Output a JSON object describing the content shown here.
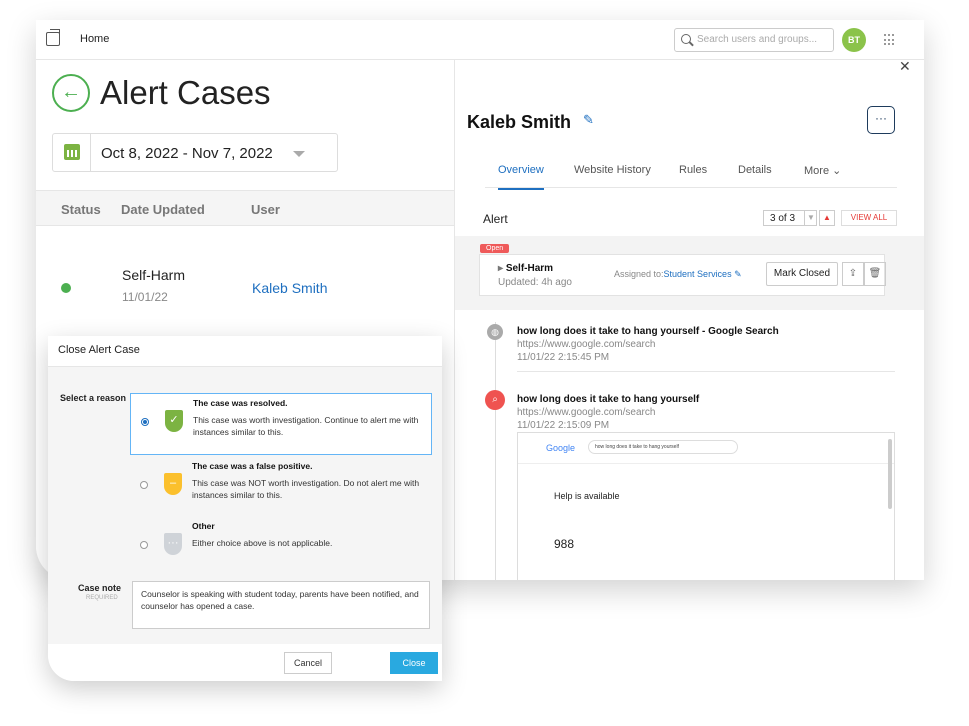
{
  "topbar": {
    "home": "Home",
    "search_placeholder": "Search users and groups...",
    "avatar": "BT"
  },
  "left": {
    "title": "Alert Cases",
    "date_range": "Oct 8, 2022 - Nov 7, 2022",
    "columns": [
      "Status",
      "Date Updated",
      "User"
    ],
    "row": {
      "type": "Self-Harm",
      "date": "11/01/22",
      "user": "Kaleb Smith"
    }
  },
  "right": {
    "name": "Kaleb Smith",
    "more_label": "···",
    "tabs": [
      "Overview",
      "Website History",
      "Rules",
      "Details",
      "More ⌄"
    ],
    "alert_label": "Alert",
    "counter": "3 of 3",
    "view_all": "VIEW ALL",
    "badge": "Open",
    "alert_type": "Self-Harm",
    "updated": "Updated: 4h ago",
    "assigned_prefix": "Assigned to:",
    "assigned_to": "Student Services",
    "mark_closed": "Mark Closed",
    "events": [
      {
        "title": "how long does it take to hang yourself - Google Search",
        "url": "https://www.google.com/search",
        "date": "11/01/22 2:15:45 PM"
      },
      {
        "title": "how long does it take to hang yourself",
        "url": "https://www.google.com/search",
        "date": "11/01/22 2:15:09 PM"
      }
    ],
    "shot": {
      "logo": "Google",
      "query": "how long does it take to hang yourself",
      "help": "Help is available",
      "number": "988"
    }
  },
  "modal": {
    "title": "Close Alert Case",
    "select_reason": "Select a reason",
    "options": [
      {
        "head": "The case was resolved.",
        "desc": "This case was worth investigation. Continue to alert me with instances similar to this."
      },
      {
        "head": "The case was a false positive.",
        "desc": "This case was NOT worth investigation. Do not alert me with instances similar to this."
      },
      {
        "head": "Other",
        "desc": "Either choice above is not applicable."
      }
    ],
    "case_note": "Case note",
    "required": "REQUIRED",
    "note_text": "Counselor is speaking with student today, parents have been notified, and counselor has opened a case.",
    "cancel": "Cancel",
    "close": "Close"
  }
}
